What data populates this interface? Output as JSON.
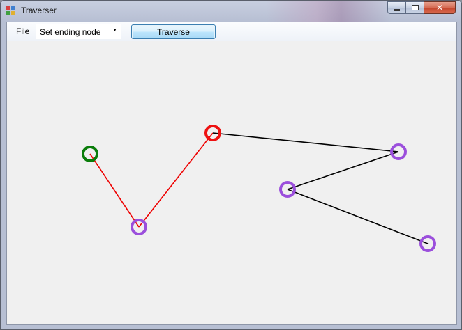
{
  "window": {
    "title": "Traverser"
  },
  "toolbar": {
    "menu_file": "File",
    "mode_select": "Set ending node",
    "traverse_button": "Traverse"
  },
  "graph": {
    "colors": {
      "start_node": "#0a7d0a",
      "end_node": "#ee1111",
      "node": "#9b4fdc",
      "path_edge": "#ee0000",
      "edge": "#000000"
    },
    "nodes": [
      {
        "id": "n1",
        "role": "start"
      },
      {
        "id": "n2",
        "role": "normal"
      },
      {
        "id": "n3",
        "role": "end"
      },
      {
        "id": "n4",
        "role": "normal"
      },
      {
        "id": "n5",
        "role": "normal"
      },
      {
        "id": "n6",
        "role": "normal"
      }
    ],
    "edges": [
      {
        "from": "n1",
        "to": "n2",
        "on_path": true
      },
      {
        "from": "n2",
        "to": "n3",
        "on_path": true
      },
      {
        "from": "n3",
        "to": "n4",
        "on_path": false
      },
      {
        "from": "n4",
        "to": "n5",
        "on_path": false
      },
      {
        "from": "n5",
        "to": "n6",
        "on_path": false
      }
    ]
  }
}
